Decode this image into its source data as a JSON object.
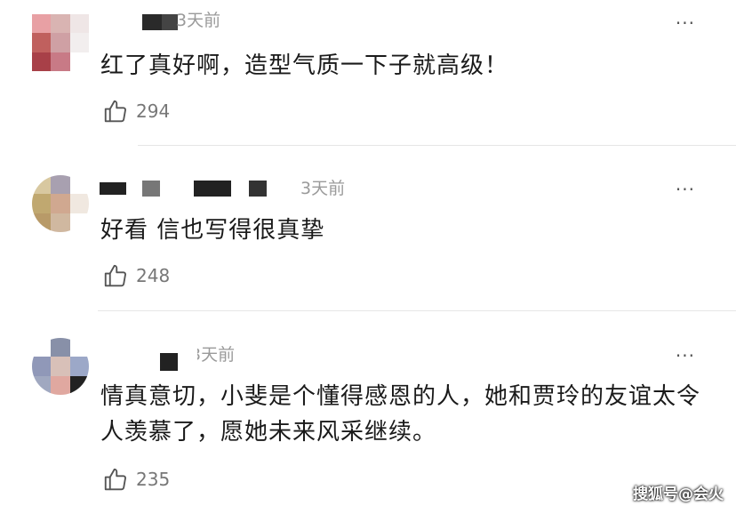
{
  "comments": [
    {
      "time": "3天前",
      "text": "红了真好啊，造型气质一下子就高级！",
      "likes": "294"
    },
    {
      "time": "3天前",
      "text": "好看  信也写得很真挚",
      "likes": "248"
    },
    {
      "time": "3天前",
      "text": "情真意切，小斐是个懂得感恩的人，她和贾玲的友谊太令人羡慕了，愿她未来风采继续。",
      "likes": "235"
    }
  ],
  "more_icon": "···",
  "like_icon": "thumbs-up-icon",
  "watermark": "搜狐号@会火"
}
